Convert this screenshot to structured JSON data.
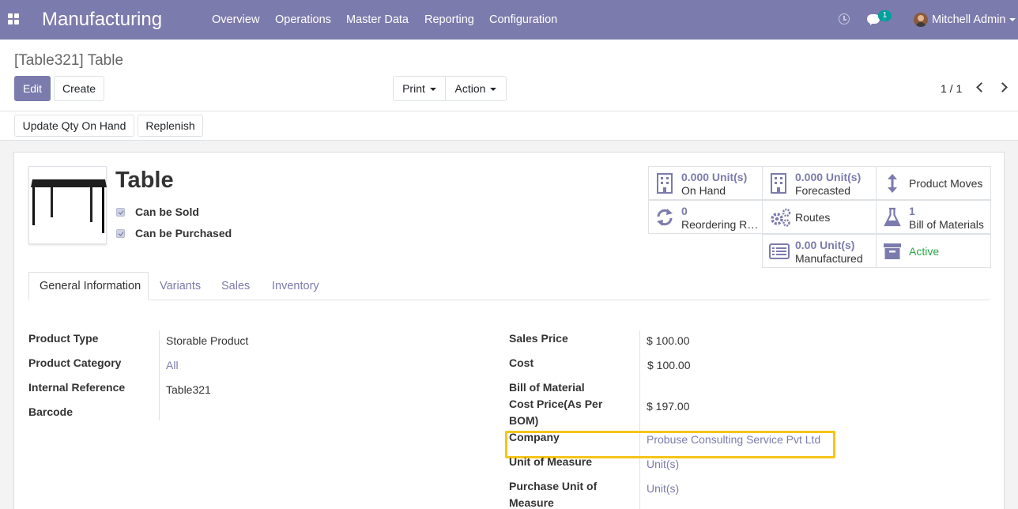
{
  "navbar": {
    "app_name": "Manufacturing",
    "menu": [
      "Overview",
      "Operations",
      "Master Data",
      "Reporting",
      "Configuration"
    ],
    "chat_badge": "1",
    "user_name": "Mitchell Admin",
    "color": "#7c7bad"
  },
  "breadcrumb": "[Table321] Table",
  "toolbar": {
    "edit": "Edit",
    "create": "Create",
    "print": "Print",
    "action": "Action",
    "pager": "1 / 1"
  },
  "statusbar": {
    "update_qty": "Update Qty On Hand",
    "replenish": "Replenish"
  },
  "product": {
    "name": "Table",
    "can_be_sold": "Can be Sold",
    "can_be_purchased": "Can be Purchased"
  },
  "smart_buttons": {
    "on_hand": {
      "value": "0.000 Unit(s)",
      "label": "On Hand",
      "icon": "building-icon"
    },
    "forecasted": {
      "value": "0.000 Unit(s)",
      "label": "Forecasted",
      "icon": "building-icon"
    },
    "product_moves": {
      "label": "Product Moves",
      "icon": "arrows-vertical-icon"
    },
    "reordering": {
      "value": "0",
      "label": "Reordering Rules",
      "icon": "refresh-icon"
    },
    "routes": {
      "label": "Routes",
      "icon": "cogs-icon"
    },
    "bom": {
      "value": "1",
      "label": "Bill of Materials",
      "icon": "flask-icon"
    },
    "manufactured": {
      "value": "0.00 Unit(s)",
      "label": "Manufactured",
      "icon": "list-icon"
    },
    "active": {
      "label": "Active",
      "icon": "archive-icon",
      "color": "#28a745"
    }
  },
  "tabs": [
    "General Information",
    "Variants",
    "Sales",
    "Inventory"
  ],
  "fields_left": {
    "product_type": {
      "label": "Product Type",
      "value": "Storable Product"
    },
    "product_category": {
      "label": "Product Category",
      "value": "All"
    },
    "internal_reference": {
      "label": "Internal Reference",
      "value": "Table321"
    },
    "barcode": {
      "label": "Barcode",
      "value": ""
    }
  },
  "fields_right": {
    "sales_price": {
      "label": "Sales Price",
      "value": "$ 100.00"
    },
    "cost": {
      "label": "Cost",
      "value": "$ 100.00"
    },
    "bom_cost_line1": "Bill of Material",
    "bom_cost_line2": "Cost Price(As Per",
    "bom_cost_line3": "BOM)",
    "bom_cost_value": "$ 197.00",
    "company": {
      "label": "Company",
      "value": "Probuse Consulting Service Pvt Ltd"
    },
    "uom": {
      "label": "Unit of Measure",
      "value": "Unit(s)"
    },
    "purchase_uom_line1": "Purchase Unit of",
    "purchase_uom_line2": "Measure",
    "purchase_uom_value": "Unit(s)"
  },
  "highlight_color": "#f5c518"
}
